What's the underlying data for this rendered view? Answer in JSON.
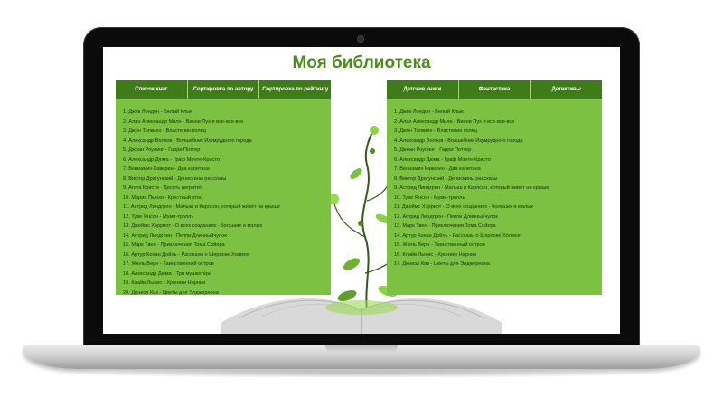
{
  "page": {
    "title": "Моя библиотека"
  },
  "left_panel": {
    "tabs": [
      {
        "label": "Список книг"
      },
      {
        "label": "Сортировка по автору"
      },
      {
        "label": "Сортировка по рейтингу"
      }
    ],
    "books": [
      "1. Джек Лондон - Белый Клык",
      "2. Алан Александр Милн - Винни Пух и все-все-все",
      "3. Джон Толкиен - Властелин колец",
      "4. Александр Волков - Волшебник Изумрудного города",
      "5. Джоан Роулинг - Гарри Поттер",
      "6. Александр Дюма - Граф Монте-Кристо",
      "7. Вениамин Каверин - Два капитана",
      "8. Виктор Драгунский - Денискины рассказы",
      "9. Агата Кристи - Десять негритят",
      "10. Марио Пьюзо - Крестный отец",
      "11. Астрид Линдгрен - Малыш и Карлсон, который живёт на крыше",
      "12. Туве Янсон - Муми-тролль",
      "13. Джеймс Хэрриот - О всех созданиях - больших и малых",
      "14. Астрид Линдгрен - Пеппи Длинныйчулок",
      "15. Марк Твен - Приключения Тома Сойера",
      "16. Артур Конан Дойль - Рассказы о Шерлоке Холмсе",
      "17. Жюль Верн - Таинственный остров",
      "18. Александр Дюма - Три мушкетёра",
      "19. Клайв Льюис - Хроники Нарнии",
      "20. Дениэл Киз - Цветы для Элджернона"
    ]
  },
  "right_panel": {
    "tabs": [
      {
        "label": "Детские книги"
      },
      {
        "label": "Фантастика"
      },
      {
        "label": "Детективы"
      }
    ],
    "books": [
      "1. Джек Лондон - Белый Клык",
      "2. Алан Александр Милн - Винни Пух и все-все-все",
      "3. Джон Толкиен - Властелин колец",
      "4. Александр Волков - Волшебник Изумрудного города",
      "5. Джоан Роулинг - Гарри Поттер",
      "6. Александр Дюма - Граф Монте-Кристо",
      "7. Вениамин Каверин - Два капитана",
      "8. Виктор Драгунский - Денискины рассказы",
      "9. Астрид Линдгрен - Малыш и Карлсон, который живёт на крыше",
      "10. Туве Янсон - Муми-тролль",
      "11. Джеймс Хэрриот - О всех созданиях - больших и малых",
      "12. Астрид Линдгрен - Пеппи Длинныйчулок",
      "13. Марк Твен - Приключения Тома Сойера",
      "14. Артур Конан Дойль - Рассказы о Шерлоке Холмсе",
      "15. Жюль Верн - Таинственный остров",
      "16. Клайв Льюис - Хроники Нарнии",
      "17. Дениэл Киз - Цветы для Элджернона"
    ]
  },
  "colors": {
    "title_green": "#4d8b1d",
    "tab_dark_green": "#3f7c19",
    "panel_green": "#7cc142"
  },
  "icons": {
    "decoration": "vine-and-book-illustration"
  }
}
